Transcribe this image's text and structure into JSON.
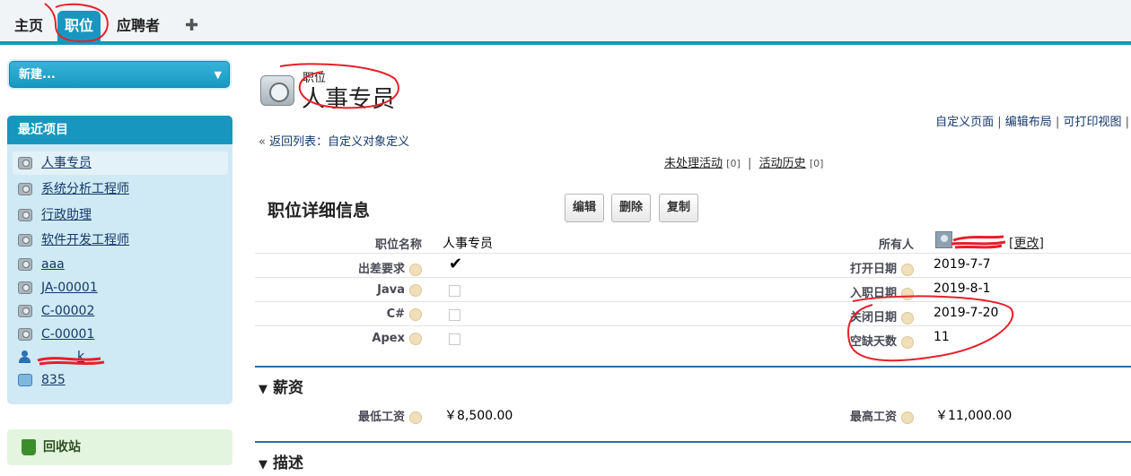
{
  "tabs": [
    {
      "label": "主页"
    },
    {
      "label": "职位"
    },
    {
      "label": "应聘者"
    }
  ],
  "tab_add_icon": "plus-icon",
  "sidebar": {
    "new_label": "新建...",
    "recent_title": "最近项目",
    "recent_items": [
      {
        "label": "人事专员",
        "icon": "camera-icon"
      },
      {
        "label": "系统分析工程师",
        "icon": "camera-icon"
      },
      {
        "label": "行政助理",
        "icon": "camera-icon"
      },
      {
        "label": "软件开发工程师",
        "icon": "camera-icon"
      },
      {
        "label": "aaa",
        "icon": "camera-icon"
      },
      {
        "label": "JA-00001",
        "icon": "camera-icon"
      },
      {
        "label": "C-00002",
        "icon": "camera-icon"
      },
      {
        "label": "C-00001",
        "icon": "camera-icon"
      },
      {
        "label": "k",
        "icon": "person-icon"
      },
      {
        "label": "835",
        "icon": "folder-icon"
      }
    ],
    "recycle_label": "回收站"
  },
  "header": {
    "object_type": "职位",
    "record_title": "人事专员",
    "links": [
      "自定义页面",
      "编辑布局",
      "可打印视图"
    ],
    "back_prefix": "«",
    "back_label": "返回列表：自定义对象定义",
    "open_activities": "未处理活动",
    "open_activities_count": "[0]",
    "activity_history": "活动历史",
    "activity_history_count": "[0]"
  },
  "detail": {
    "title": "职位详细信息",
    "buttons": [
      "编辑",
      "删除",
      "复制"
    ],
    "fields": {
      "position_name_label": "职位名称",
      "position_name_value": "人事专员",
      "travel_label": "出差要求",
      "java_label": "Java",
      "csharp_label": "C#",
      "apex_label": "Apex",
      "owner_label": "所有人",
      "owner_change": "[更改]",
      "open_date_label": "打开日期",
      "open_date_value": "2019-7-7",
      "hire_date_label": "入职日期",
      "hire_date_value": "2019-8-1",
      "close_date_label": "关闭日期",
      "close_date_value": "2019-7-20",
      "vacancy_days_label": "空缺天数",
      "vacancy_days_value": "11"
    },
    "checkboxes": {
      "travel": true,
      "java": false,
      "csharp": false,
      "apex": false
    }
  },
  "salary": {
    "title": "薪资",
    "min_label": "最低工资",
    "min_value": "￥8,500.00",
    "max_label": "最高工资",
    "max_value": "￥11,000.00"
  },
  "description": {
    "title": "描述"
  },
  "colors": {
    "accent": "#1797c0",
    "link": "#15386a",
    "annotation_red": "#e5202a"
  }
}
